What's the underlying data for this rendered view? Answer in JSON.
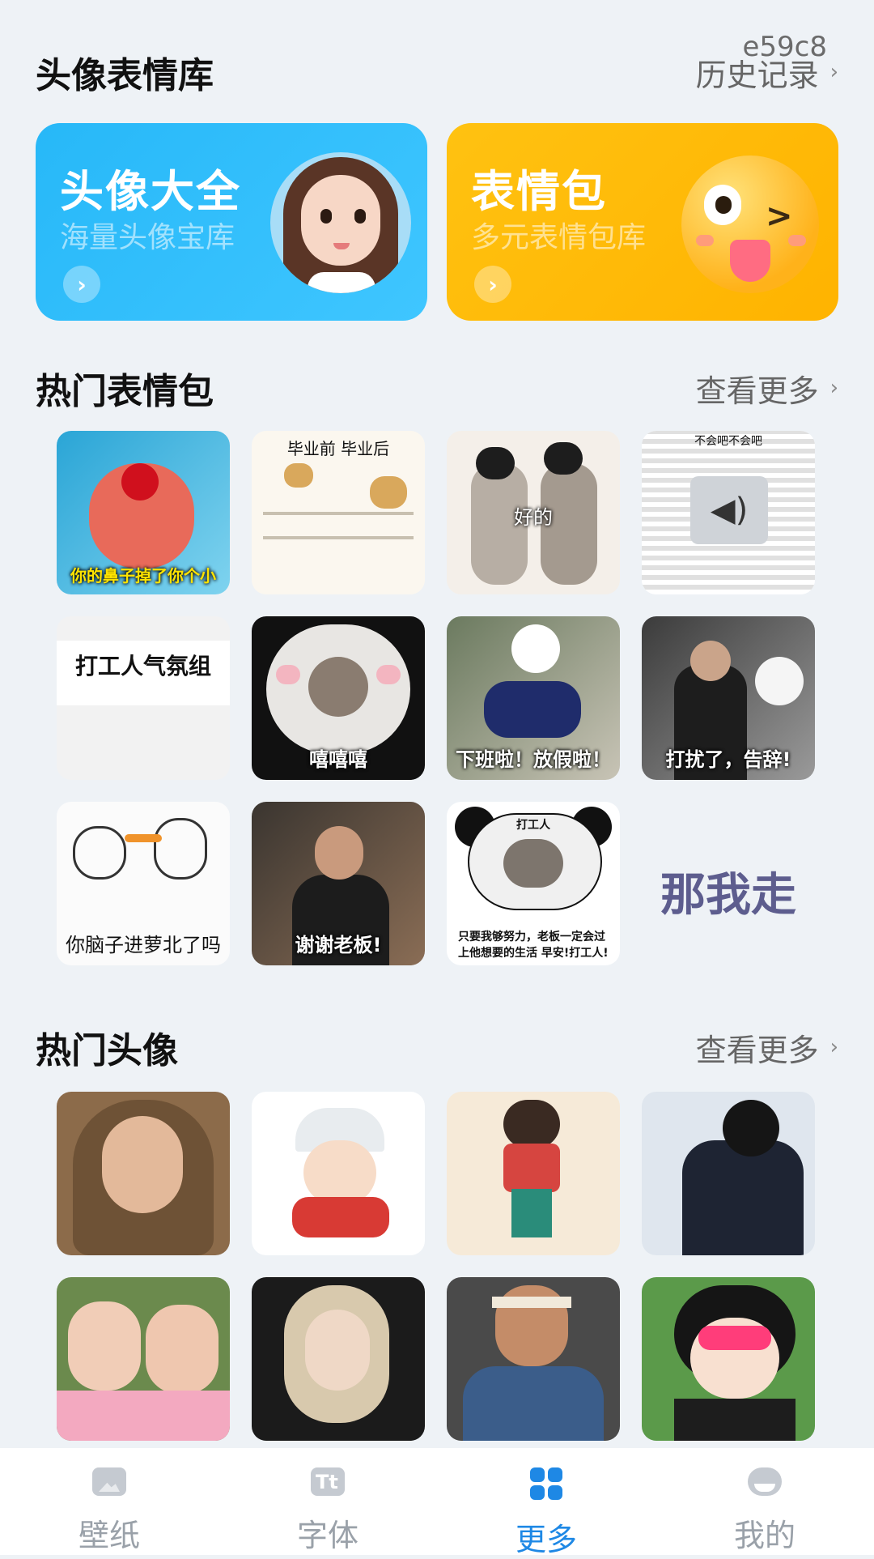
{
  "watermark": "e59c8",
  "library": {
    "title": "头像表情库",
    "history_link": "历史记录",
    "cards": [
      {
        "title": "头像大全",
        "subtitle": "海量头像宝库",
        "color": "#2bbcfb"
      },
      {
        "title": "表情包",
        "subtitle": "多元表情包库",
        "color": "#ffbd0d"
      }
    ]
  },
  "hot_stickers": {
    "title": "热门表情包",
    "more": "查看更多",
    "items": [
      {
        "caption": "你的鼻子掉了你个小",
        "icon": "cartoon-nose-sticker"
      },
      {
        "caption": "毕业前   毕业后",
        "icon": "doge-graduation-sticker"
      },
      {
        "caption": "好的",
        "icon": "bowing-couple-sticker"
      },
      {
        "caption": "不会吧不会吧",
        "icon": "text-wall-sticker"
      },
      {
        "caption": "打工人气氛组",
        "icon": "text-definition-sticker"
      },
      {
        "caption": "嘻嘻嘻",
        "icon": "panda-face-sticker"
      },
      {
        "caption": "下班啦！放假啦！",
        "icon": "motorbike-sticker"
      },
      {
        "caption": "打扰了，告辞!",
        "icon": "man-leaving-sticker"
      },
      {
        "caption": "你脑子进萝北了吗",
        "icon": "doodle-carrot-sticker"
      },
      {
        "caption": "谢谢老板!",
        "icon": "man-phone-sticker"
      },
      {
        "caption": "只要我够努力，老板一定会过上他想要的生活 早安!打工人!",
        "header": "打工人",
        "icon": "panda-worker-sticker"
      },
      {
        "caption": "那我走",
        "icon": "pixel-text-sticker"
      }
    ]
  },
  "hot_avatars": {
    "title": "热门头像",
    "more": "查看更多",
    "items": [
      {
        "icon": "girl-scarf-avatar"
      },
      {
        "icon": "anime-girl-skateboard-avatar"
      },
      {
        "icon": "cartoon-scale-avatar"
      },
      {
        "icon": "man-snow-avatar"
      },
      {
        "icon": "twin-girls-avatar"
      },
      {
        "icon": "blonde-woman-avatar"
      },
      {
        "icon": "costume-man-avatar"
      },
      {
        "icon": "heart-glasses-cartoon-avatar"
      }
    ]
  },
  "tabbar": {
    "items": [
      {
        "label": "壁纸",
        "icon": "image-icon"
      },
      {
        "label": "字体",
        "icon": "font-icon"
      },
      {
        "label": "更多",
        "icon": "grid-icon",
        "active": true
      },
      {
        "label": "我的",
        "icon": "profile-icon"
      }
    ],
    "active_color": "#1e88e5"
  }
}
